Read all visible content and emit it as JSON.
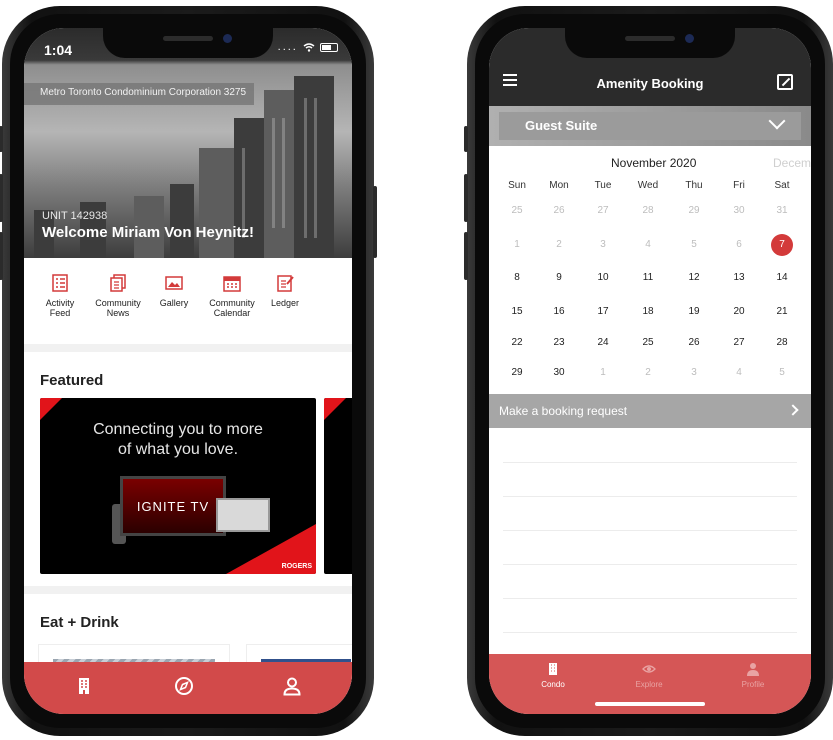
{
  "left_phone": {
    "status_bar": {
      "time": "1:04",
      "signal": "....",
      "wifi_icon": "wifi-icon",
      "battery_icon": "battery-icon"
    },
    "hero": {
      "corporation": "Metro Toronto Condominium Corporation 3275",
      "unit": "UNIT 142938",
      "welcome": "Welcome Miriam Von Heynitz!"
    },
    "quick_links": [
      {
        "label_1": "Activity",
        "label_2": "Feed",
        "icon": "list-icon"
      },
      {
        "label_1": "Community",
        "label_2": "News",
        "icon": "news-icon"
      },
      {
        "label_1": "Gallery",
        "label_2": "",
        "icon": "image-icon"
      },
      {
        "label_1": "Community",
        "label_2": "Calendar",
        "icon": "calendar-icon"
      },
      {
        "label_1": "Ledger",
        "label_2": "",
        "icon": "ledger-icon"
      }
    ],
    "featured": {
      "title": "Featured",
      "headline_1": "Connecting you to more",
      "headline_2": "of what you love.",
      "product": "IGNITE TV",
      "brand": "ROGERS"
    },
    "eat_drink": {
      "title": "Eat + Drink"
    },
    "tab_bar": {
      "items": [
        "building-icon",
        "compass-icon",
        "user-icon"
      ],
      "color": "#d24a4a"
    }
  },
  "right_phone": {
    "header": {
      "title": "Amenity Booking",
      "menu_icon": "hamburger-icon",
      "action_icon": "expand-icon"
    },
    "amenity_select": {
      "value": "Guest Suite"
    },
    "calendar": {
      "month": "November 2020",
      "next_month": "Decemb",
      "weekdays": [
        "Sun",
        "Mon",
        "Tue",
        "Wed",
        "Thu",
        "Fri",
        "Sat"
      ],
      "weeks": [
        [
          "25",
          "26",
          "27",
          "28",
          "29",
          "30",
          "31"
        ],
        [
          "1",
          "2",
          "3",
          "4",
          "5",
          "6",
          "7"
        ],
        [
          "8",
          "9",
          "10",
          "11",
          "12",
          "13",
          "14"
        ],
        [
          "15",
          "16",
          "17",
          "18",
          "19",
          "20",
          "21"
        ],
        [
          "22",
          "23",
          "24",
          "25",
          "26",
          "27",
          "28"
        ],
        [
          "29",
          "30",
          "1",
          "2",
          "3",
          "4",
          "5"
        ]
      ],
      "selected": "7",
      "accent_color": "#d33a3a"
    },
    "booking_request": {
      "label": "Make a booking request"
    },
    "tab_bar": {
      "items": [
        {
          "label": "Condo",
          "icon": "building-icon"
        },
        {
          "label": "Explore",
          "icon": "eye-icon"
        },
        {
          "label": "Profile",
          "icon": "person-icon"
        }
      ],
      "color": "#d55656"
    }
  }
}
